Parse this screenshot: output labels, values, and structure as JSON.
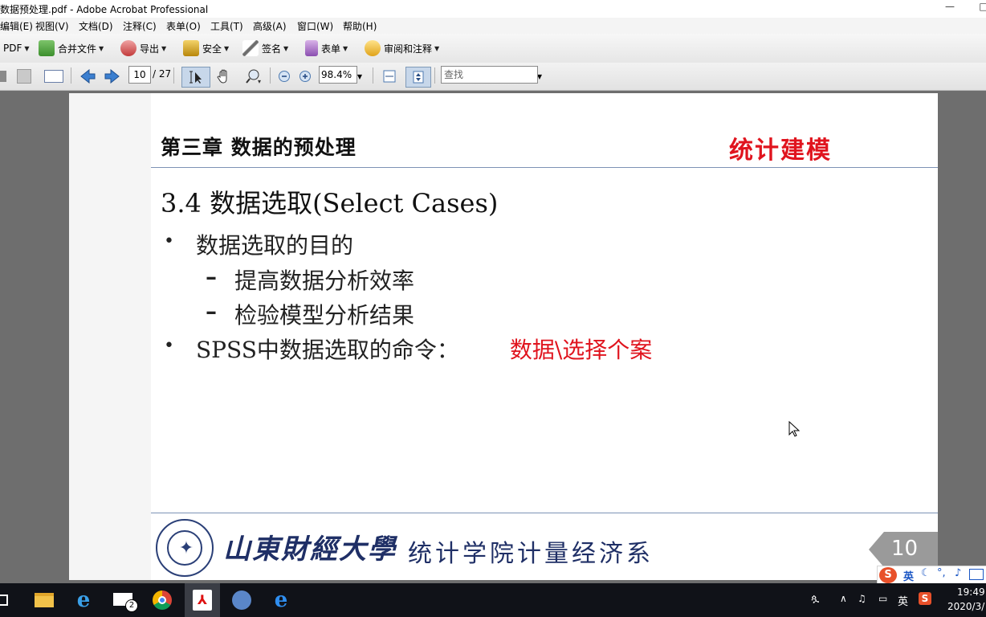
{
  "window": {
    "title": "数据预处理.pdf - Adobe Acrobat Professional",
    "minimize_glyph": "—",
    "restore_glyph": "□"
  },
  "menu": {
    "items": [
      "编辑(E)",
      "视图(V)",
      "文档(D)",
      "注释(C)",
      "表单(O)",
      "工具(T)",
      "高级(A)",
      "窗口(W)",
      "帮助(H)"
    ]
  },
  "toolbar": {
    "pdf_label": "PDF",
    "combine_label": "合并文件",
    "export_label": "导出",
    "security_label": "安全",
    "sign_label": "签名",
    "forms_label": "表单",
    "review_label": "审阅和注释"
  },
  "nav": {
    "current_page": "10",
    "total_pages": "/ 27",
    "zoom": "98.4%",
    "find_placeholder": "查找"
  },
  "slide": {
    "chapter": "第三章 数据的预处理",
    "brand": "统计建模",
    "section_title": "3.4 数据选取(Select Cases)",
    "bullet1": "数据选取的目的",
    "sub1": "提高数据分析效率",
    "sub2": "检验模型分析结果",
    "bullet2_text": "SPSS中数据选取的命令：",
    "bullet2_command": "数据\\选择个案",
    "bullet_glyph": "•",
    "dash_glyph": "–",
    "university": "山東財經大學",
    "department": "统计学院计量经济系",
    "page_number": "10"
  },
  "ime": {
    "mode": "英"
  },
  "taskbar": {
    "mail_badge": "2",
    "tray_lang": "英",
    "time": "19:49",
    "date": "2020/3/"
  },
  "colors": {
    "accent_red": "#e0141e",
    "navy": "#1f2f66"
  }
}
